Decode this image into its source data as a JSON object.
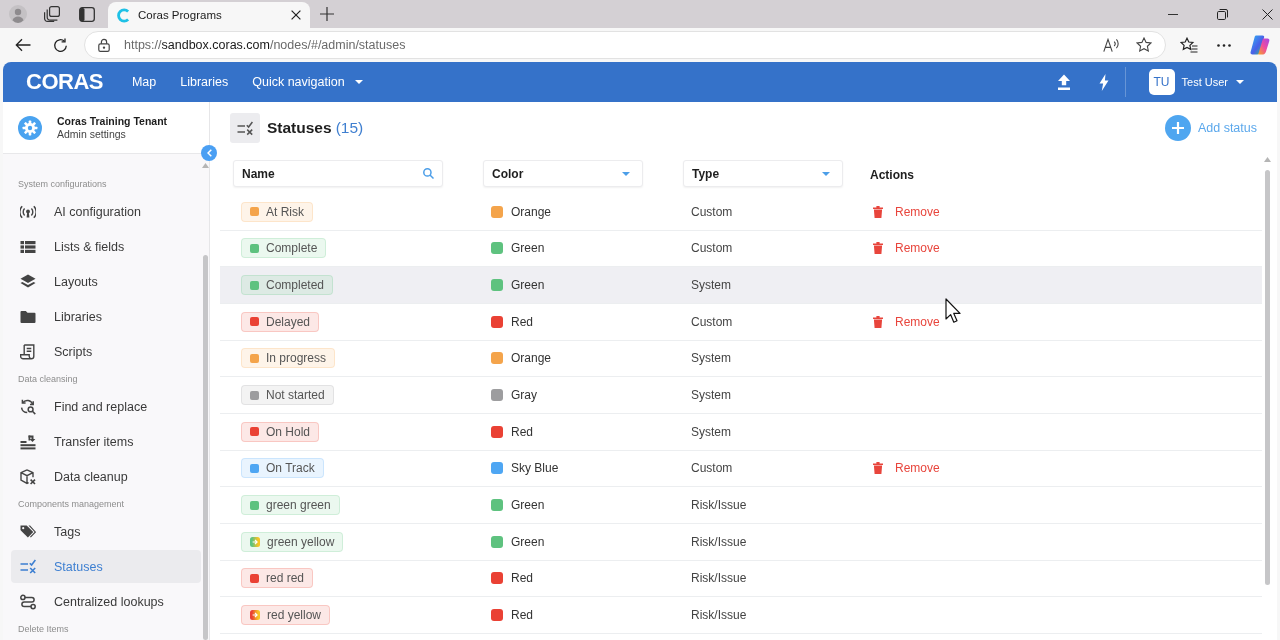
{
  "browser": {
    "tab": {
      "title": "Coras Programs"
    },
    "url": {
      "scheme": "https://",
      "host": "sandbox.coras.com",
      "path": "/nodes/#/admin/statuses"
    }
  },
  "header": {
    "logo": "CORAS",
    "nav": [
      {
        "label": "Map",
        "dropdown": false
      },
      {
        "label": "Libraries",
        "dropdown": false
      },
      {
        "label": "Quick navigation",
        "dropdown": true
      }
    ],
    "user": {
      "initials": "TU",
      "name": "Test User"
    }
  },
  "sidebar": {
    "tenant": "Coras Training Tenant",
    "subtitle": "Admin settings",
    "sections": [
      {
        "title": "System configurations",
        "items": [
          {
            "label": "AI configuration",
            "selected": false
          },
          {
            "label": "Lists & fields",
            "selected": false
          },
          {
            "label": "Layouts",
            "selected": false
          },
          {
            "label": "Libraries",
            "selected": false
          },
          {
            "label": "Scripts",
            "selected": false
          }
        ]
      },
      {
        "title": "Data cleansing",
        "items": [
          {
            "label": "Find and replace",
            "selected": false
          },
          {
            "label": "Transfer items",
            "selected": false
          },
          {
            "label": "Data cleanup",
            "selected": false
          }
        ]
      },
      {
        "title": "Components management",
        "items": [
          {
            "label": "Tags",
            "selected": false
          },
          {
            "label": "Statuses",
            "selected": true
          },
          {
            "label": "Centralized lookups",
            "selected": false
          }
        ]
      },
      {
        "title": "Delete Items"
      }
    ]
  },
  "page": {
    "title": "Statuses",
    "count": "(15)",
    "add_label": "Add status"
  },
  "table": {
    "columns": [
      {
        "kind": "search",
        "placeholder": "Name"
      },
      {
        "kind": "dropdown",
        "label": "Color"
      },
      {
        "kind": "dropdown",
        "label": "Type"
      },
      {
        "kind": "plain",
        "label": "Actions"
      }
    ],
    "rows": [
      {
        "name": "At Risk",
        "kind": "solid",
        "color": "#f4a44b",
        "color_name": "Orange",
        "type": "Custom",
        "action": "Remove",
        "highlighted": false
      },
      {
        "name": "Complete",
        "kind": "solid",
        "color": "#5ec27f",
        "color_name": "Green",
        "type": "Custom",
        "action": "Remove",
        "highlighted": false
      },
      {
        "name": "Completed",
        "kind": "solid",
        "color": "#5ec27f",
        "color_name": "Green",
        "type": "System",
        "highlighted": true
      },
      {
        "name": "Delayed",
        "kind": "solid",
        "color": "#ea4134",
        "color_name": "Red",
        "type": "Custom",
        "action": "Remove",
        "highlighted": false
      },
      {
        "name": "In progress",
        "kind": "solid",
        "color": "#f4a44b",
        "color_name": "Orange",
        "type": "System",
        "highlighted": false
      },
      {
        "name": "Not started",
        "kind": "solid",
        "color": "#9d9d9f",
        "color_name": "Gray",
        "type": "System",
        "highlighted": false
      },
      {
        "name": "On Hold",
        "kind": "solid",
        "color": "#ea4134",
        "color_name": "Red",
        "type": "System",
        "highlighted": false
      },
      {
        "name": "On Track",
        "kind": "solid",
        "color": "#4ea6f3",
        "color_name": "Sky Blue",
        "type": "Custom",
        "action": "Remove",
        "highlighted": false
      },
      {
        "name": "green green",
        "kind": "solid",
        "color": "#5ec27f",
        "color_name": "Green",
        "type": "Risk/Issue",
        "highlighted": false
      },
      {
        "name": "green yellow",
        "kind": "transition",
        "color": "#5ec27f",
        "end": {
          "color": "#f7c325"
        },
        "color_name": "Green",
        "type": "Risk/Issue",
        "highlighted": false
      },
      {
        "name": "red red",
        "kind": "solid",
        "color": "#ea4134",
        "color_name": "Red",
        "type": "Risk/Issue",
        "highlighted": false
      },
      {
        "name": "red yellow",
        "kind": "transition",
        "color": "#ea4134",
        "end": {
          "color": "#f7c325"
        },
        "color_name": "Red",
        "type": "Risk/Issue",
        "highlighted": false
      }
    ]
  }
}
